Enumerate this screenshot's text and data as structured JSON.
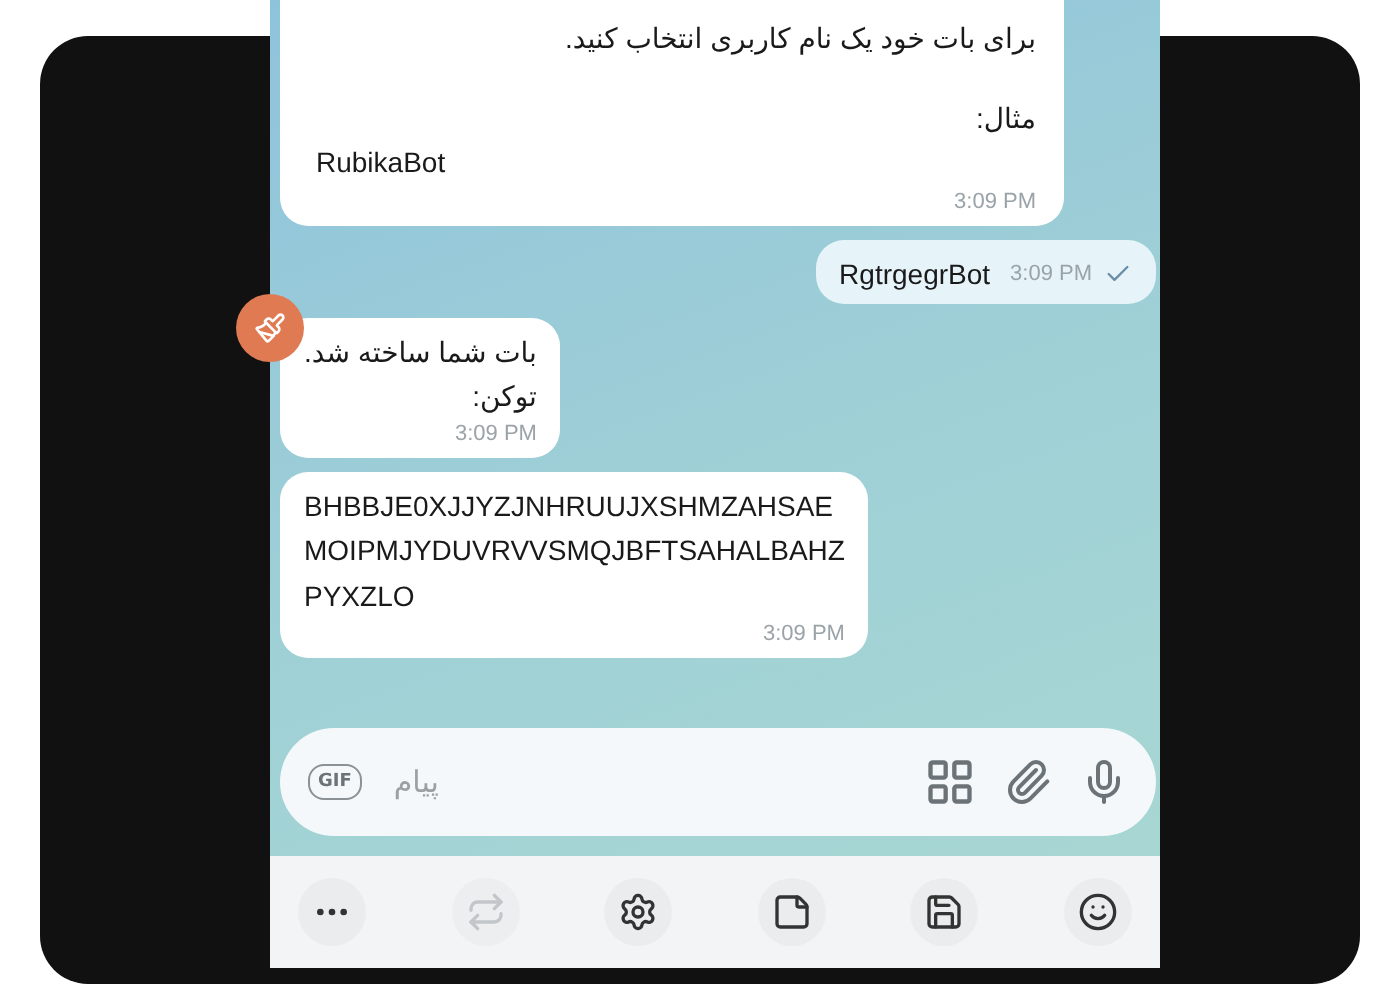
{
  "messages": [
    {
      "kind": "incoming",
      "avatar": false,
      "lines": [
        {
          "text": "برای بات خود یک نام کاربری انتخاب کنید.",
          "kind": "rtl"
        },
        {
          "text": "مثال:",
          "kind": "rtl"
        },
        {
          "text": "RubikaBot",
          "kind": "ltr"
        }
      ],
      "time": "3:09 PM",
      "read": false
    },
    {
      "kind": "outgoing",
      "avatar": false,
      "lines": [
        {
          "text": "RgtrgegrBot",
          "kind": "ltr"
        }
      ],
      "time": "3:09 PM",
      "read": true
    },
    {
      "kind": "incoming",
      "avatar": true,
      "lines": [
        {
          "text": "بات شما ساخته شد.",
          "kind": "rtl"
        },
        {
          "text": "توکن:",
          "kind": "rtl"
        }
      ],
      "time": "3:09 PM",
      "read": false
    },
    {
      "kind": "incoming",
      "avatar": false,
      "lines": [
        {
          "text": "BHBBJE0XJJYZJNHRUUJXSHMZAHSAE",
          "kind": "ltr"
        },
        {
          "text": "MOIPMJYDUVRVVSMQJBFTSAHALBAHZ",
          "kind": "ltr"
        },
        {
          "text": "PYXZLO",
          "kind": "ltr"
        }
      ],
      "time": "3:09 PM",
      "read": false
    }
  ],
  "composer": {
    "gif_label": "GIF",
    "placeholder": "پیام"
  },
  "toolbar": [
    {
      "kind": "more",
      "disabled": false
    },
    {
      "kind": "swap",
      "disabled": true
    },
    {
      "kind": "settings",
      "disabled": false
    },
    {
      "kind": "note",
      "disabled": false
    },
    {
      "kind": "save",
      "disabled": false
    },
    {
      "kind": "emoji",
      "disabled": false
    }
  ]
}
